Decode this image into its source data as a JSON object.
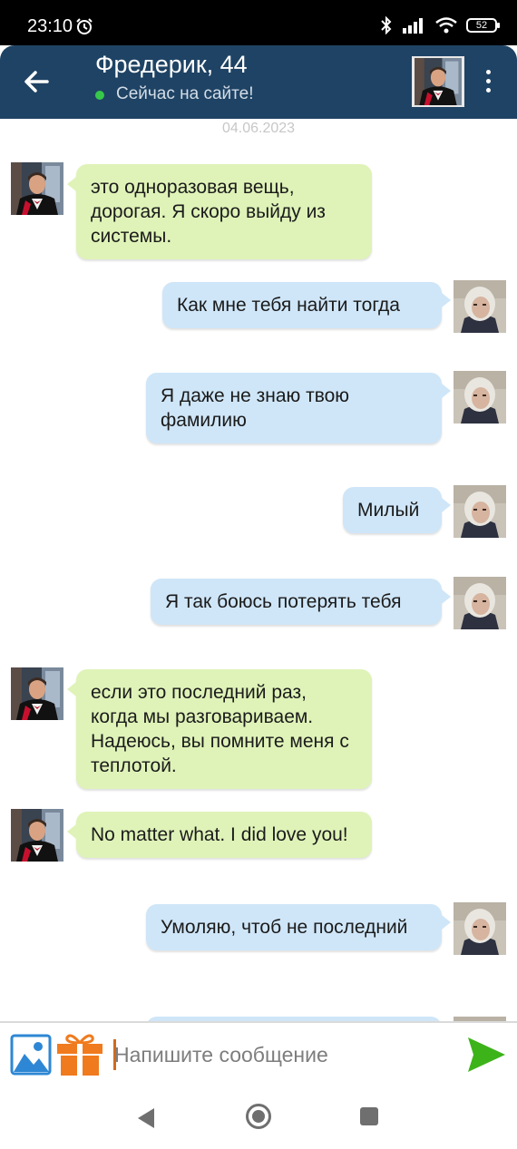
{
  "status_bar": {
    "time": "23:10",
    "battery": "52"
  },
  "header": {
    "name": "Фредерик, 44",
    "status": "Сейчас на сайте!"
  },
  "chat": {
    "date": "04.06.2023",
    "messages": [
      {
        "dir": "in",
        "text": "это одноразовая вещь, дорогая. Я скоро выйду из системы."
      },
      {
        "dir": "out",
        "text": "Как мне тебя найти тогда"
      },
      {
        "dir": "out",
        "text": "Я даже не знаю твою фамилию"
      },
      {
        "dir": "out",
        "text": "Милый"
      },
      {
        "dir": "out",
        "text": "Я так боюсь потерять тебя"
      },
      {
        "dir": "in",
        "text": "если это последний раз, когда мы разговариваем. Надеюсь, вы помните меня с теплотой."
      },
      {
        "dir": "in",
        "text": "No matter what. I did love you!"
      },
      {
        "dir": "out",
        "text": "Умоляю, чтоб не последний"
      }
    ]
  },
  "input": {
    "placeholder": "Напишите сообщение"
  },
  "colors": {
    "header_bg": "#1f4364",
    "incoming_bubble": "#dff3b8",
    "outgoing_bubble": "#cfe6f8",
    "send": "#3db31a",
    "gift": "#f07b1e",
    "online": "#37c84a"
  },
  "icons": [
    "alarm-icon",
    "bluetooth-icon",
    "signal-icon",
    "wifi-icon",
    "battery-icon",
    "back-arrow-icon",
    "more-vert-icon",
    "image-icon",
    "gift-icon",
    "send-icon",
    "nav-back-icon",
    "nav-home-icon",
    "nav-recents-icon"
  ]
}
